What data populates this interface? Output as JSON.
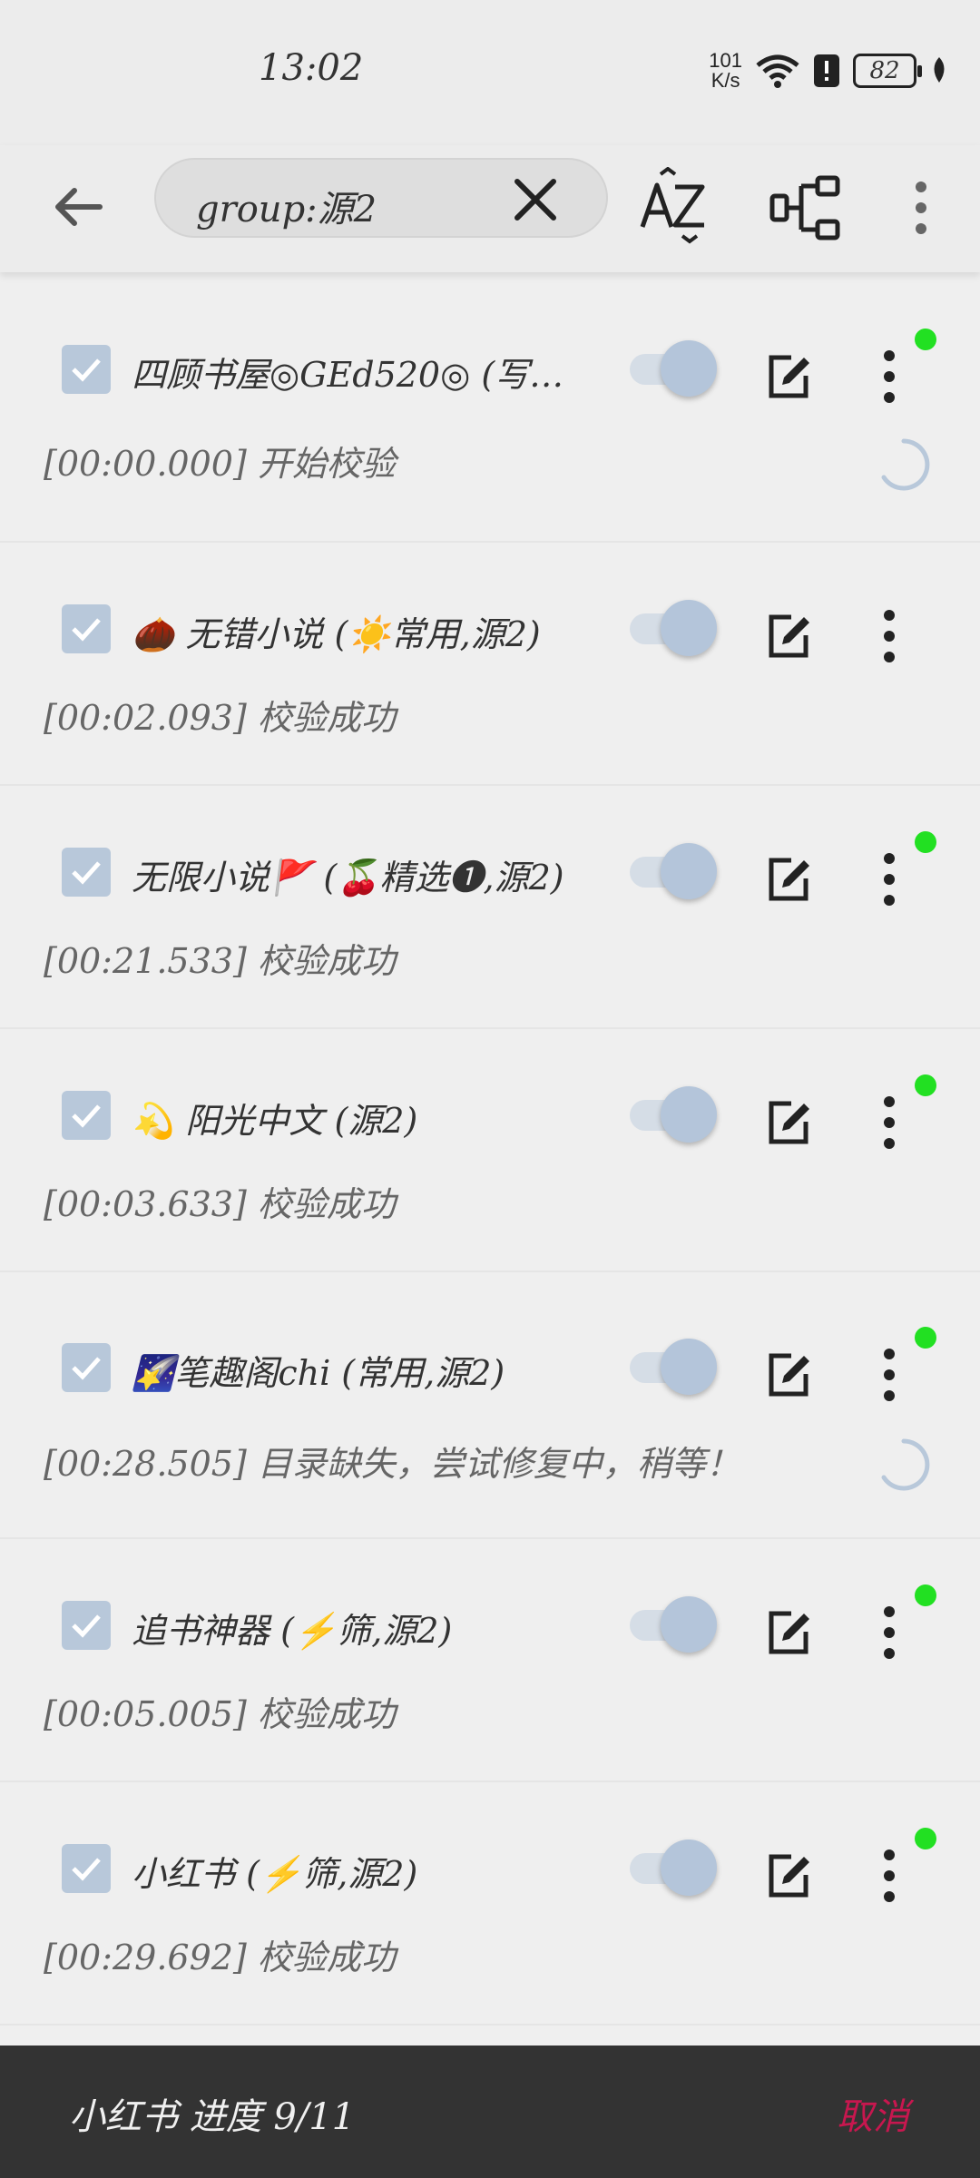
{
  "status_bar": {
    "time": "13:02",
    "net_speed_value": "101",
    "net_speed_unit": "K/s",
    "battery": "82"
  },
  "toolbar": {
    "search_value": "group:源2"
  },
  "items": [
    {
      "name": "四顾书屋◎GEd520◎ (写…",
      "status": "[00:00.000] 开始校验",
      "dot": true,
      "spinner": true
    },
    {
      "name": "🌰 无错小说 (☀️常用,源2)",
      "status": "[00:02.093] 校验成功",
      "dot": false,
      "spinner": false
    },
    {
      "name": "无限小说🚩 (🍒精选❶,源2)",
      "status": "[00:21.533] 校验成功",
      "dot": true,
      "spinner": false
    },
    {
      "name": "💫 阳光中文 (源2)",
      "status": "[00:03.633] 校验成功",
      "dot": true,
      "spinner": false
    },
    {
      "name": "🌠笔趣阁chi (常用,源2)",
      "status": "[00:28.505] 目录缺失，尝试修复中，稍等！",
      "dot": true,
      "spinner": true
    },
    {
      "name": "追书神器 (⚡筛,源2)",
      "status": "[00:05.005] 校验成功",
      "dot": true,
      "spinner": false
    },
    {
      "name": "小红书 (⚡筛,源2)",
      "status": "[00:29.692] 校验成功",
      "dot": true,
      "spinner": false
    }
  ],
  "bottom_bar": {
    "progress": "小红书 进度 9/11",
    "cancel_label": "取消"
  },
  "colors": {
    "accent": "#b8c8da",
    "online_dot": "#22e022",
    "cancel": "#c7174f"
  }
}
